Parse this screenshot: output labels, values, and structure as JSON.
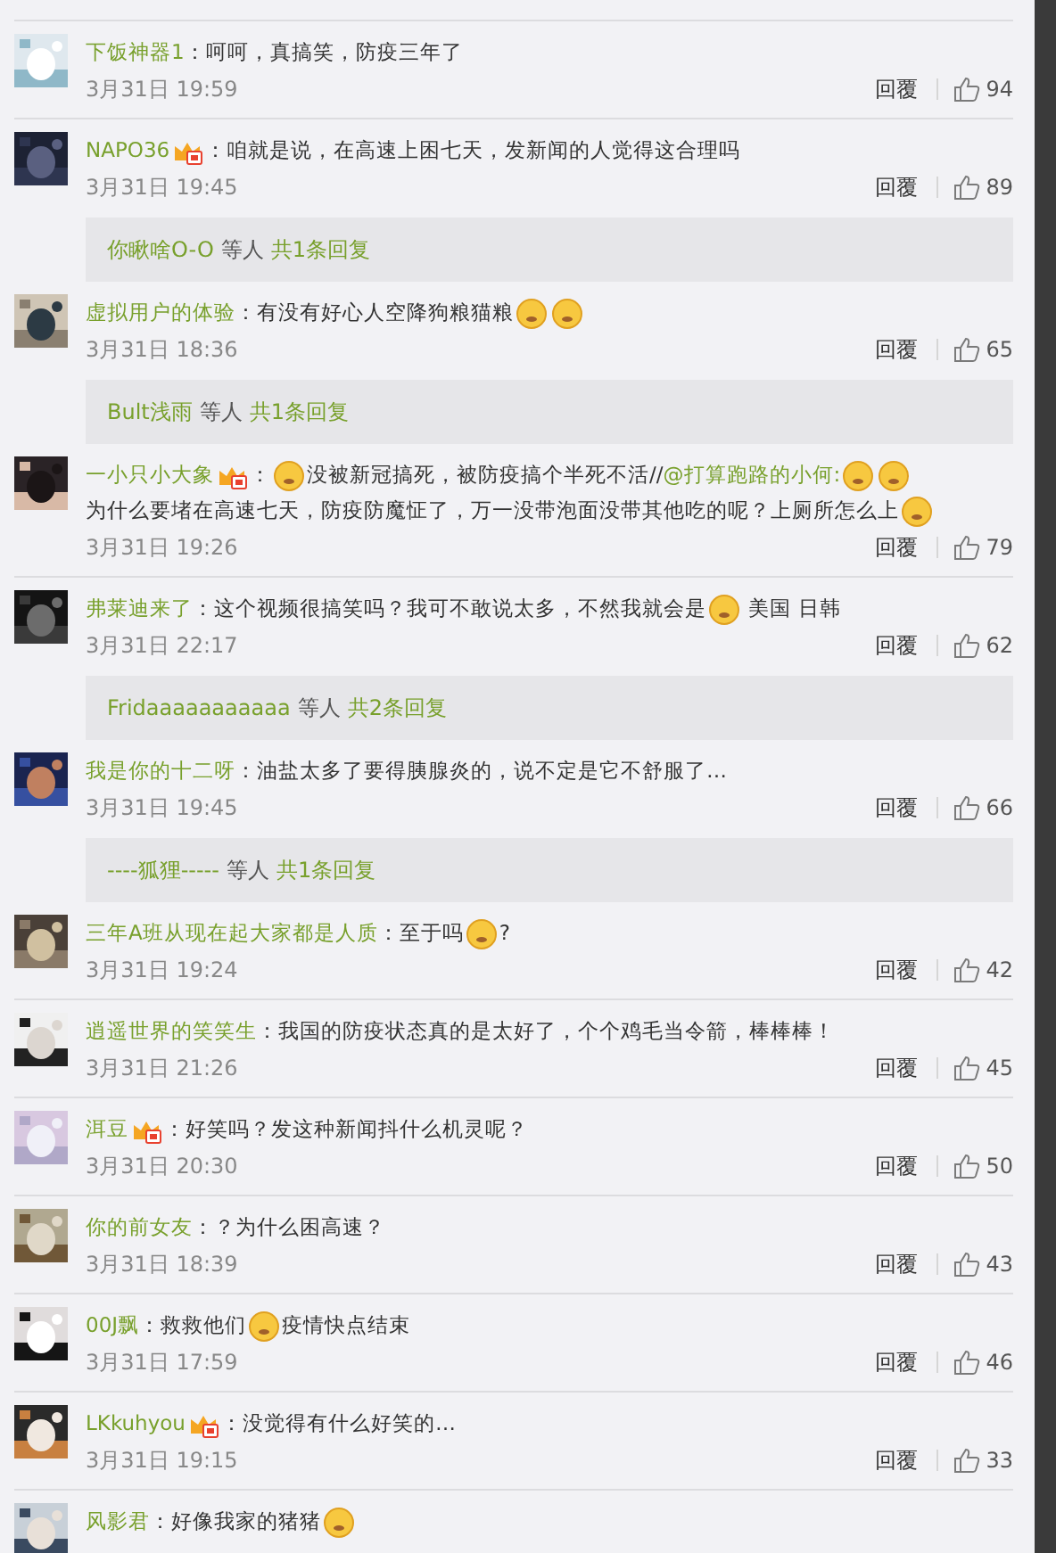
{
  "comments": [
    {
      "name": "下饭神器1",
      "vip": false,
      "parts": [
        {
          "kind": "text",
          "text": "：呵呵，真搞笑，防疫三年了"
        }
      ],
      "date": "3月31日 19:59",
      "reply": "回覆",
      "likes": "94"
    },
    {
      "name": "NAPO36",
      "vip": true,
      "parts": [
        {
          "kind": "text",
          "text": "：咱就是说，在高速上困七天，发新闻的人觉得这合理吗"
        }
      ],
      "date": "3月31日 19:45",
      "reply": "回覆",
      "likes": "89",
      "replies": {
        "user": "你瞅啥O-O",
        "suffix": "等人",
        "total": "共1条回复"
      }
    },
    {
      "name": "虚拟用户的体验",
      "vip": false,
      "parts": [
        {
          "kind": "text",
          "text": "：有没有好心人空降狗粮猫粮"
        },
        {
          "kind": "emoji"
        },
        {
          "kind": "emoji"
        }
      ],
      "date": "3月31日 18:36",
      "reply": "回覆",
      "likes": "65",
      "replies": {
        "user": "Bult浅雨",
        "suffix": "等人",
        "total": "共1条回复"
      }
    },
    {
      "name": "一小只小大象",
      "vip": true,
      "parts": [
        {
          "kind": "text",
          "text": "："
        },
        {
          "kind": "emoji"
        },
        {
          "kind": "text",
          "text": "没被新冠搞死，被防疫搞个半死不活//"
        },
        {
          "kind": "mention",
          "text": "@打算跑路的小何:"
        },
        {
          "kind": "emoji"
        },
        {
          "kind": "emoji"
        },
        {
          "kind": "text",
          "text": "为什么要堵"
        },
        {
          "kind": "text",
          "text": "在高速七天，防疫防魔怔了，万一没带泡面没带其他吃的呢？上厕所怎么上"
        },
        {
          "kind": "emoji"
        }
      ],
      "date": "3月31日 19:26",
      "reply": "回覆",
      "likes": "79"
    },
    {
      "name": "弗莱迪来了",
      "vip": false,
      "parts": [
        {
          "kind": "text",
          "text": "：这个视频很搞笑吗？我可不敢说太多，不然我就会是"
        },
        {
          "kind": "emoji"
        },
        {
          "kind": "text",
          "text": " 美国 日韩"
        }
      ],
      "date": "3月31日 22:17",
      "reply": "回覆",
      "likes": "62",
      "replies": {
        "user": "Fridaaaaaaaaaaa",
        "suffix": "等人",
        "total": "共2条回复"
      }
    },
    {
      "name": "我是你的十二呀",
      "vip": false,
      "parts": [
        {
          "kind": "text",
          "text": "：油盐太多了要得胰腺炎的，说不定是它不舒服了…"
        }
      ],
      "date": "3月31日 19:45",
      "reply": "回覆",
      "likes": "66",
      "replies": {
        "user": "----狐狸-----",
        "suffix": "等人",
        "total": "共1条回复"
      }
    },
    {
      "name": "三年A班从现在起大家都是人质",
      "vip": false,
      "parts": [
        {
          "kind": "text",
          "text": "：至于吗"
        },
        {
          "kind": "emoji"
        },
        {
          "kind": "text",
          "text": "?"
        }
      ],
      "date": "3月31日 19:24",
      "reply": "回覆",
      "likes": "42"
    },
    {
      "name": "逍遥世界的笑笑生",
      "vip": false,
      "parts": [
        {
          "kind": "text",
          "text": "：我国的防疫状态真的是太好了，个个鸡毛当令箭，棒棒棒！"
        }
      ],
      "date": "3月31日 21:26",
      "reply": "回覆",
      "likes": "45"
    },
    {
      "name": "洱豆",
      "vip": true,
      "parts": [
        {
          "kind": "text",
          "text": "：好笑吗？发这种新闻抖什么机灵呢？"
        }
      ],
      "date": "3月31日 20:30",
      "reply": "回覆",
      "likes": "50"
    },
    {
      "name": "你的前女友",
      "vip": false,
      "parts": [
        {
          "kind": "text",
          "text": "：？为什么困高速？"
        }
      ],
      "date": "3月31日 18:39",
      "reply": "回覆",
      "likes": "43"
    },
    {
      "name": "00J飘",
      "vip": false,
      "parts": [
        {
          "kind": "text",
          "text": "：救救他们"
        },
        {
          "kind": "emoji"
        },
        {
          "kind": "text",
          "text": "疫情快点结束"
        }
      ],
      "date": "3月31日 17:59",
      "reply": "回覆",
      "likes": "46"
    },
    {
      "name": "LKkuhyou",
      "vip": true,
      "parts": [
        {
          "kind": "text",
          "text": "：没觉得有什么好笑的…"
        }
      ],
      "date": "3月31日 19:15",
      "reply": "回覆",
      "likes": "33"
    },
    {
      "name": "风影君",
      "vip": false,
      "parts": [
        {
          "kind": "text",
          "text": "：好像我家的猪猪"
        },
        {
          "kind": "emoji"
        }
      ]
    }
  ]
}
